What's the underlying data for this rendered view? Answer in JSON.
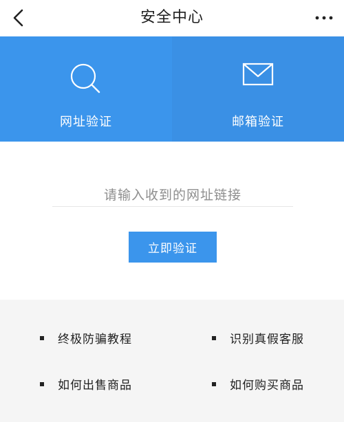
{
  "header": {
    "title": "安全中心",
    "back_icon": "chevron-left-icon",
    "more_icon": "more-dots-icon"
  },
  "tabs": [
    {
      "label": "网址验证",
      "icon": "search-icon",
      "selected": true
    },
    {
      "label": "邮箱验证",
      "icon": "mail-icon",
      "selected": false
    }
  ],
  "verify": {
    "input_placeholder": "请输入收到的网址链接",
    "input_value": "",
    "button_label": "立即验证"
  },
  "links": [
    {
      "label": "终极防骗教程"
    },
    {
      "label": "识别真假客服"
    },
    {
      "label": "如何出售商品"
    },
    {
      "label": "如何购买商品"
    }
  ],
  "colors": {
    "accent": "#3b95ec",
    "tab_secondary": "#3a90e5",
    "footer_bg": "#f5f5f5"
  }
}
